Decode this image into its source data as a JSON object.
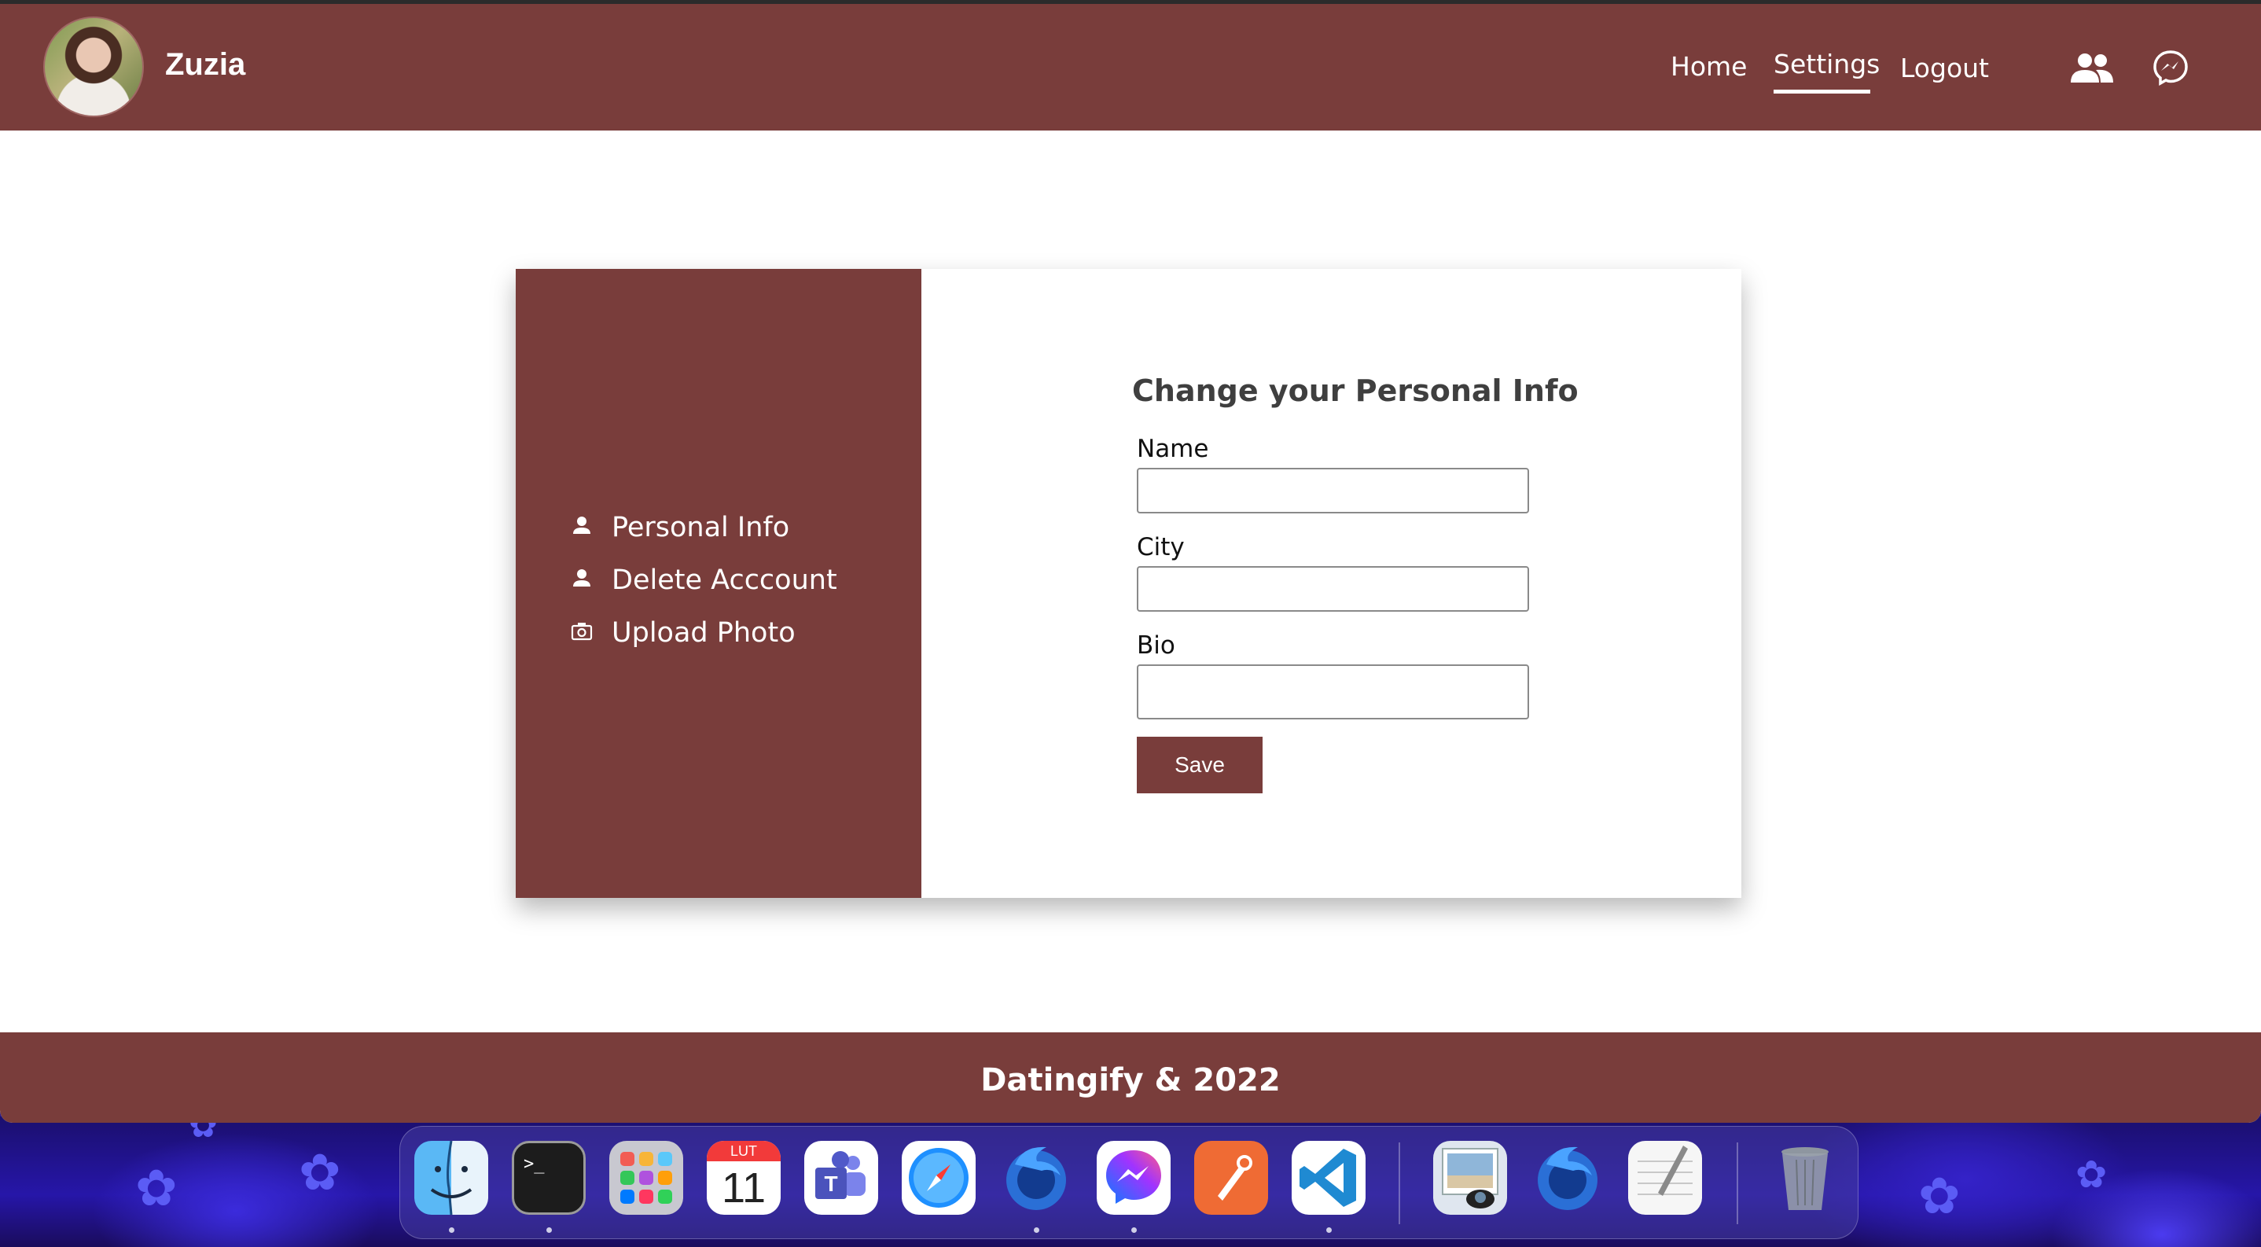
{
  "navbar": {
    "user_name": "Zuzia",
    "links": {
      "home": "Home",
      "settings": "Settings",
      "logout": "Logout"
    },
    "active_link": "Settings",
    "icons": [
      "friends-icon",
      "messenger-icon"
    ]
  },
  "sidebar": {
    "items": [
      {
        "label": "Personal Info",
        "icon": "person-icon"
      },
      {
        "label": "Delete Acccount",
        "icon": "person-icon"
      },
      {
        "label": "Upload Photo",
        "icon": "camera-icon"
      }
    ]
  },
  "form": {
    "title": "Change your Personal Info",
    "fields": {
      "name": {
        "label": "Name",
        "value": ""
      },
      "city": {
        "label": "City",
        "value": ""
      },
      "bio": {
        "label": "Bio",
        "value": ""
      }
    },
    "save_label": "Save"
  },
  "footer": {
    "text": "Datingify & 2022"
  },
  "dock": {
    "calendar": {
      "month": "LUT",
      "day": "11"
    },
    "apps": [
      "Finder",
      "Terminal",
      "Launchpad",
      "Calendar",
      "Microsoft Teams",
      "Safari",
      "Firefox",
      "Messenger",
      "Postman",
      "Visual Studio Code",
      "Preview",
      "Firefox",
      "TextEdit",
      "Trash"
    ]
  },
  "colors": {
    "brand": "#793d3b",
    "text_dark": "#3f3f3f",
    "white": "#ffffff"
  }
}
